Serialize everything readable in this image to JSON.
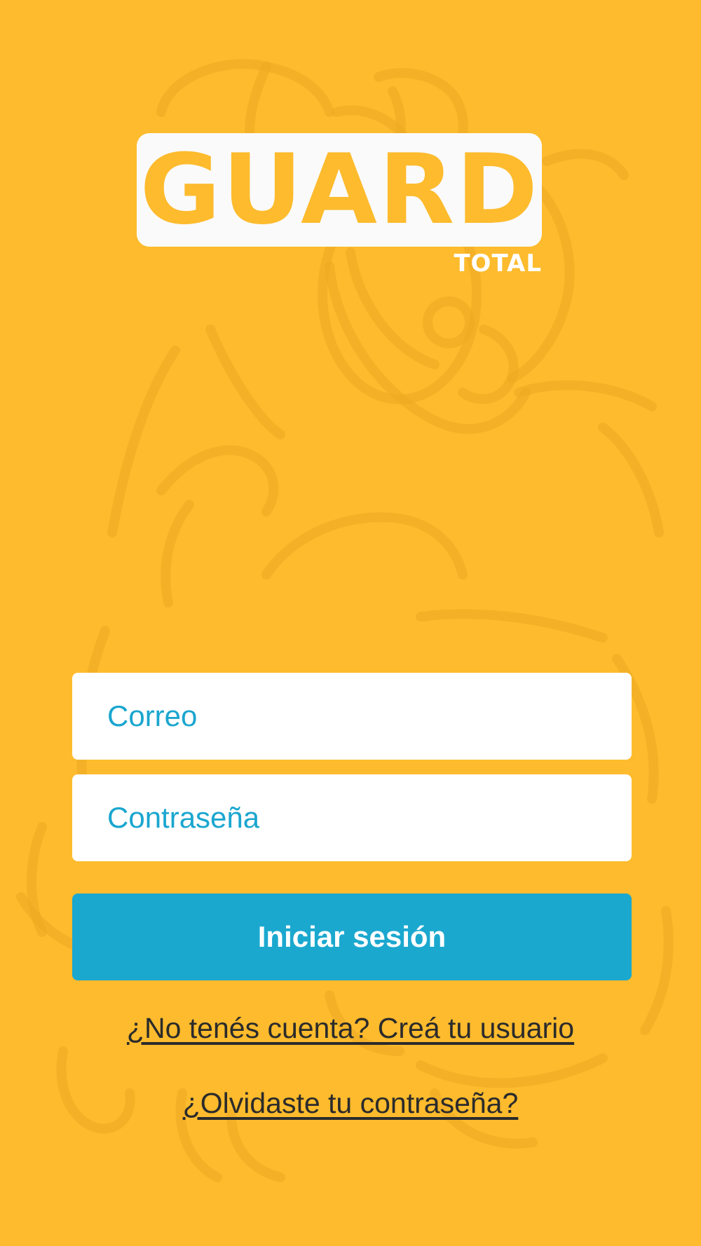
{
  "logo": {
    "main": "GUARD",
    "sub": "TOTAL"
  },
  "form": {
    "email_placeholder": "Correo",
    "password_placeholder": "Contraseña",
    "login_label": "Iniciar sesión"
  },
  "links": {
    "register": "¿No tenés cuenta? Creá tu usuario",
    "forgot": "¿Olvidaste tu contraseña?"
  },
  "colors": {
    "background": "#FDBB2D",
    "accent": "#1BA8CF",
    "field_bg": "#FFFFFF",
    "link_text": "#2B2B2B"
  },
  "icons": [
    "dog-mascot-illustration"
  ]
}
